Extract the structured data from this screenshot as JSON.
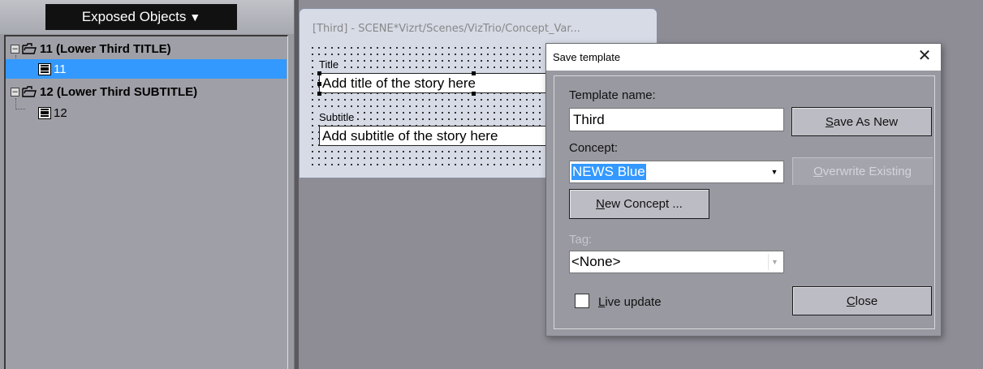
{
  "colors": {
    "selection": "#3399ff",
    "desktop": "#8e8d96",
    "dialog_bg": "#9899a1"
  },
  "exposed_panel": {
    "title": "Exposed Objects",
    "caret_icon": "triangle-down-icon",
    "tree": [
      {
        "label": "11 (Lower Third TITLE)",
        "child": "11",
        "child_selected": true
      },
      {
        "label": "12 (Lower Third SUBTITLE)",
        "child": "12",
        "child_selected": false
      }
    ]
  },
  "scene_window": {
    "title": "[Third] - SCENE*Vizrt/Scenes/VizTrio/Concept_Var...",
    "fields": [
      {
        "label": "Title",
        "value": "Add title of the story here"
      },
      {
        "label": "Subtitle",
        "value": "Add subtitle of the story here"
      }
    ]
  },
  "dialog": {
    "title": "Save template",
    "close_icon": "close-icon",
    "template_name_label": "Template name:",
    "template_name_value": "Third",
    "save_as_new_button": {
      "pre": "",
      "accel": "S",
      "post": "ave As New"
    },
    "concept_label": "Concept:",
    "concept_value": "NEWS Blue",
    "overwrite_button": {
      "pre": "",
      "accel": "O",
      "post": "verwrite Existing"
    },
    "new_concept_button": {
      "pre": "",
      "accel": "N",
      "post": "ew Concept ..."
    },
    "tag_label": "Tag:",
    "tag_value": "<None>",
    "live_update": {
      "pre": "",
      "accel": "L",
      "post": "ive update",
      "checked": false
    },
    "close_button": {
      "pre": "",
      "accel": "C",
      "post": "lose"
    }
  }
}
